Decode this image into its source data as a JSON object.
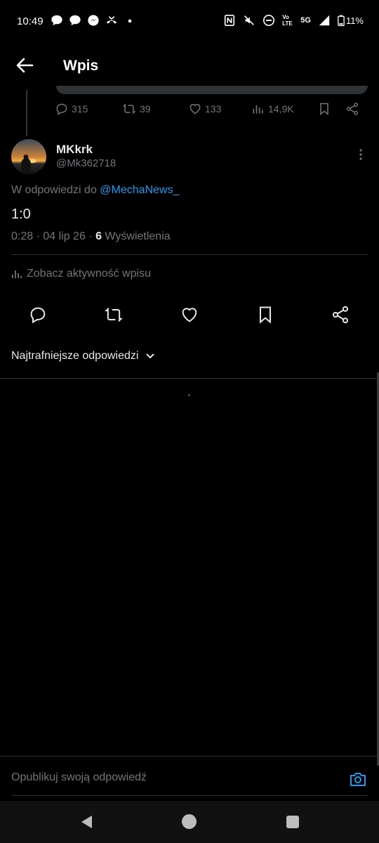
{
  "status_bar": {
    "time": "10:49",
    "battery": "11%",
    "network": "5G",
    "volte": "Vo LTE"
  },
  "header": {
    "title": "Wpis"
  },
  "parent_tweet_actions": {
    "replies": "315",
    "retweets": "39",
    "likes": "133",
    "views": "14,9K"
  },
  "tweet": {
    "display_name": "MKkrk",
    "handle": "@Mk362718",
    "replying_prefix": "W odpowiedzi do ",
    "replying_to": "@MechaNews_",
    "text": "1:0",
    "time_date": "0:28 · 04 lip 26 · ",
    "views_count": "6",
    "views_label": " Wyświetlenia",
    "activity_link": "Zobacz aktywność wpisu"
  },
  "replies_section": {
    "sort_label": "Najtrafniejsze odpowiedzi"
  },
  "compose": {
    "placeholder": "Opublikuj swoją odpowiedź"
  },
  "colors": {
    "accent": "#1d9bf0",
    "muted": "#71767b",
    "background": "#000000"
  }
}
